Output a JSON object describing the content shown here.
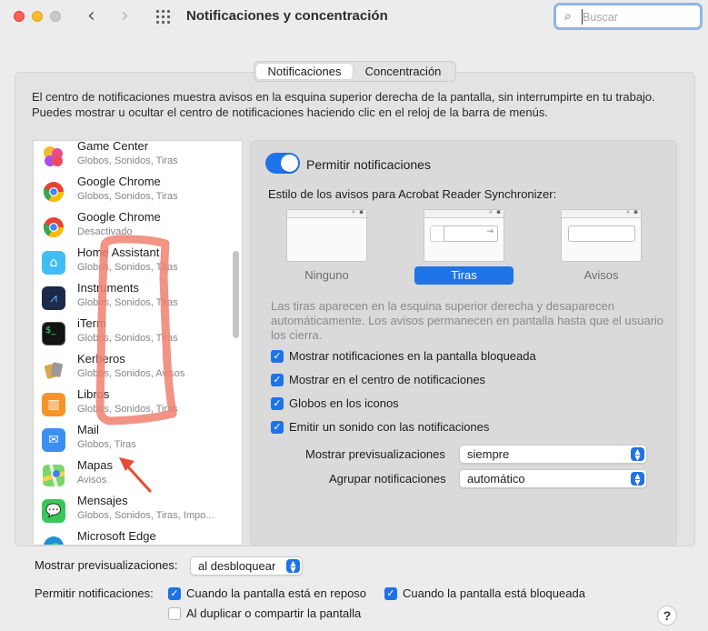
{
  "window": {
    "title": "Notificaciones y concentración",
    "search_placeholder": "Buscar"
  },
  "tabs": [
    {
      "label": "Notificaciones",
      "active": true
    },
    {
      "label": "Concentración",
      "active": false
    }
  ],
  "description": "El centro de notificaciones muestra avisos en la esquina superior derecha de la pantalla, sin interrumpirte en tu trabajo. Puedes mostrar u ocultar el centro de notificaciones haciendo clic en el reloj de la barra de menús.",
  "apps": [
    {
      "name": "Game Center",
      "sub": "Globos, Sonidos, Tiras",
      "icon": "game-center-icon"
    },
    {
      "name": "Google Chrome",
      "sub": "Globos, Sonidos, Tiras",
      "icon": "chrome-icon"
    },
    {
      "name": "Google Chrome",
      "sub": "Desactivado",
      "icon": "chrome-icon"
    },
    {
      "name": "Home Assistant",
      "sub": "Globos, Sonidos, Tiras",
      "icon": "home-assistant-icon"
    },
    {
      "name": "Instruments",
      "sub": "Globos, Sonidos, Tiras",
      "icon": "instruments-icon"
    },
    {
      "name": "iTerm",
      "sub": "Globos, Sonidos, Tiras",
      "icon": "iterm-icon"
    },
    {
      "name": "Kerberos",
      "sub": "Globos, Sonidos, Avisos",
      "icon": "kerberos-icon"
    },
    {
      "name": "Libros",
      "sub": "Globos, Sonidos, Tiras",
      "icon": "books-icon"
    },
    {
      "name": "Mail",
      "sub": "Globos, Tiras",
      "icon": "mail-icon"
    },
    {
      "name": "Mapas",
      "sub": "Avisos",
      "icon": "maps-icon"
    },
    {
      "name": "Mensajes",
      "sub": "Globos, Sonidos, Tiras, Impo...",
      "icon": "messages-icon"
    },
    {
      "name": "Microsoft Edge",
      "sub": "",
      "icon": "edge-icon"
    }
  ],
  "panel": {
    "allow_notifications_label": "Permitir notificaciones",
    "allow_notifications_on": true,
    "style_label": "Estilo de los avisos para Acrobat Reader Synchronizer:",
    "styles": [
      {
        "label": "Ninguno",
        "selected": false
      },
      {
        "label": "Tiras",
        "selected": true
      },
      {
        "label": "Avisos",
        "selected": false
      }
    ],
    "note": "Las tiras aparecen en la esquina superior derecha y desaparecen automáticamente. Los avisos permanecen en pantalla hasta que el usuario los cierra.",
    "checks": [
      {
        "label": "Mostrar notificaciones en la pantalla bloqueada",
        "checked": true
      },
      {
        "label": "Mostrar en el centro de notificaciones",
        "checked": true
      },
      {
        "label": "Globos en los iconos",
        "checked": true
      },
      {
        "label": "Emitir un sonido con las notificaciones",
        "checked": true
      }
    ],
    "preview_label": "Mostrar previsualizaciones",
    "preview_value": "siempre",
    "group_label": "Agrupar notificaciones",
    "group_value": "automático"
  },
  "bottom": {
    "preview_label": "Mostrar previsualizaciones:",
    "preview_value": "al desbloquear",
    "allow_label": "Permitir notificaciones:",
    "checks": [
      {
        "label": "Cuando la pantalla está en reposo",
        "checked": true
      },
      {
        "label": "Cuando la pantalla está bloqueada",
        "checked": true
      },
      {
        "label": "Al duplicar o compartir la pantalla",
        "checked": false
      }
    ]
  },
  "help_label": "?",
  "colors": {
    "accent": "#1f73e8",
    "annotation": "#f08070"
  }
}
